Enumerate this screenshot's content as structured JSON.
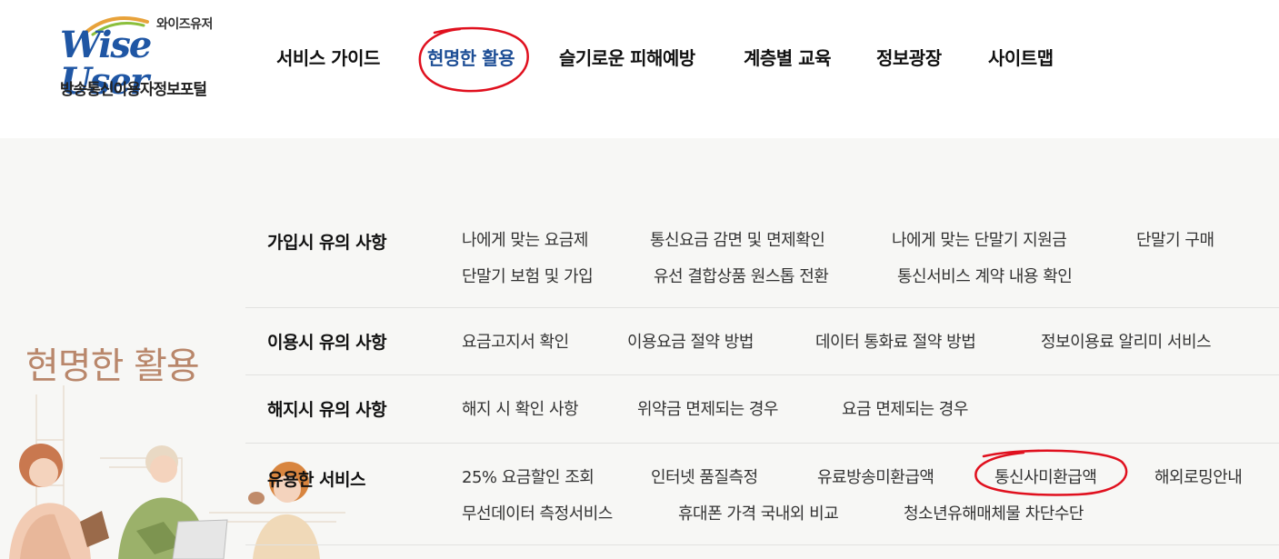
{
  "logo": {
    "small_text": "와이즈유저",
    "brand_text": "Wise User",
    "sub_text": "방송통신이용자정보포털"
  },
  "nav": {
    "items": [
      {
        "label": "서비스 가이드"
      },
      {
        "label": "현명한 활용"
      },
      {
        "label": "슬기로운 피해예방"
      },
      {
        "label": "계층별 교육"
      },
      {
        "label": "정보광장"
      },
      {
        "label": "사이트맵"
      }
    ]
  },
  "menu": {
    "section_title": "현명한 활용",
    "rows": [
      {
        "title": "가입시 유의 사항",
        "links": [
          "나에게 맞는 요금제",
          "통신요금 감면 및 면제확인",
          "나에게 맞는 단말기 지원금",
          "단말기 구매",
          "단말기 보험 및 가입",
          "유선 결합상품 원스톱 전환",
          "통신서비스 계약 내용 확인"
        ]
      },
      {
        "title": "이용시 유의 사항",
        "links": [
          "요금고지서 확인",
          "이용요금 절약 방법",
          "데이터 통화료 절약 방법",
          "정보이용료 알리미 서비스"
        ]
      },
      {
        "title": "해지시 유의 사항",
        "links": [
          "해지 시 확인 사항",
          "위약금 면제되는 경우",
          "요금 면제되는 경우"
        ]
      },
      {
        "title": "유용한 서비스",
        "links": [
          "25% 요금할인 조회",
          "인터넷 품질측정",
          "유료방송미환급액",
          "통신사미환급액",
          "해외로밍안내",
          "무선데이터 측정서비스",
          "휴대폰 가격 국내외 비교",
          "청소년유해매체물 차단수단"
        ]
      }
    ]
  },
  "colors": {
    "brand_blue": "#1f56a4",
    "active_nav": "#1f4f96",
    "section_title": "#b9876b",
    "annotation_red": "#e0101e",
    "panel_bg": "#f7f7f5"
  }
}
